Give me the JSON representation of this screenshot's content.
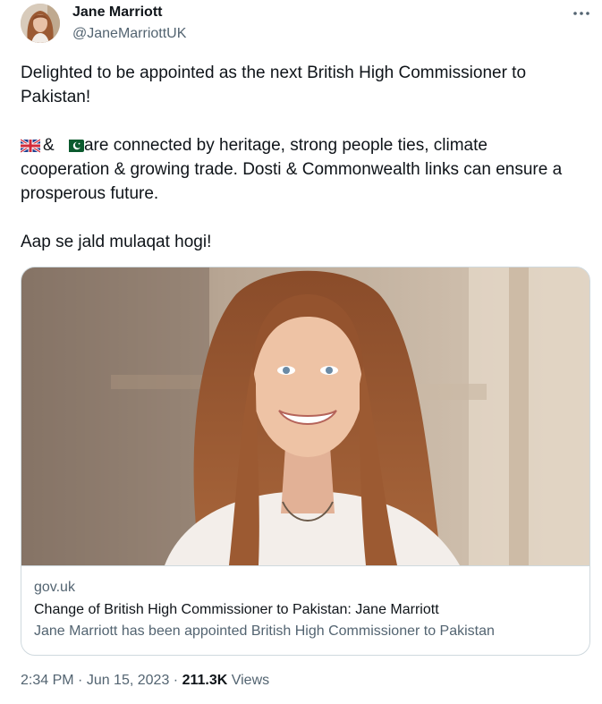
{
  "author": {
    "display_name": "Jane Marriott",
    "handle": "@JaneMarriottUK",
    "avatar_icon": "profile-photo"
  },
  "more_icon": "more-horizontal-icon",
  "tweet": {
    "line1": "Delighted to be appointed as the next British High Commissioner to",
    "line2": "Pakistan!",
    "flag_uk_icon": "flag-united-kingdom-icon",
    "amp": "&",
    "flag_pk_icon": "flag-pakistan-icon",
    "line3": "are connected by heritage, strong people ties, climate",
    "line4": "cooperation & growing trade. Dosti & Commonwealth links can ensure a",
    "line5": "prosperous future.",
    "line6": "Aap se jald mulaqat hogi!"
  },
  "card": {
    "image": "portrait-photo",
    "domain": "gov.uk",
    "title": "Change of British High Commissioner to Pakistan: Jane Marriott",
    "description": "Jane Marriott has been appointed British High Commissioner to Pakistan"
  },
  "meta": {
    "time": "2:34 PM",
    "sep1": " · ",
    "date": "Jun 15, 2023",
    "sep2": " · ",
    "views_count": "211.3K",
    "views_label": " Views"
  },
  "colors": {
    "text_primary": "#0f1419",
    "text_secondary": "#536471",
    "border": "#cfd9de"
  }
}
